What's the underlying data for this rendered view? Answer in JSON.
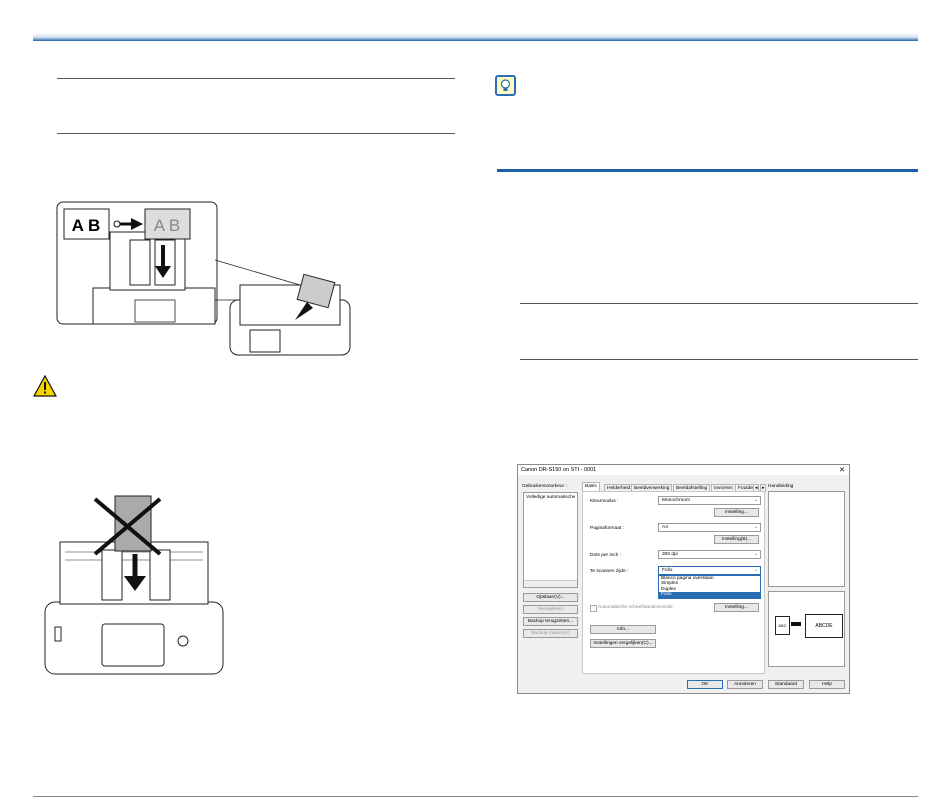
{
  "dialog": {
    "title": "Canon DR-S150 on STI - 0001",
    "close": "✕",
    "profiles_label": "Gebruikersvoorkeur :",
    "profile_item": "Volledige automatische",
    "profile_buttons": {
      "save": "Opslaan(V)...",
      "delete": "Verwijderen",
      "restore": "Backup terugzetten...",
      "backup": "Backup maken(K)"
    },
    "tabs": [
      "Basis",
      "Helderheid",
      "Beeldverwerking",
      "Beeldafstelling",
      "Invoeren",
      "Foutdet"
    ],
    "manual_label": "Handleiding",
    "fields": {
      "color_mode_label": "Kleurmodus :",
      "color_mode_value": "Monochroom",
      "page_size_label": "Paginaformaat :",
      "page_size_value": "A4",
      "dpi_label": "Dots per inch :",
      "dpi_value": "300 dpi",
      "side_label": "Te scannen zijde :",
      "side_value": "Folio"
    },
    "settings_buttons": {
      "color": "Instelling...",
      "size": "Instelling(B)...",
      "straighten": "Instelling..."
    },
    "side_options": [
      "Blanco pagina overslaan",
      "Simplex",
      "Duplex",
      "Folio"
    ],
    "side_selected_index": 3,
    "straighten_label": "Automatische scheefstandcorrectie",
    "info_button": "Info...",
    "compare_button": "Instellingen vergelijken(C)...",
    "footer_buttons": {
      "ok": "OK",
      "cancel": "Annuleren",
      "default": "Standaard",
      "help": "Help"
    },
    "preview": {
      "left_text": "ABC",
      "right_text": "ABCDE"
    }
  },
  "illustrations": {
    "top_box_left": "A B",
    "top_box_right": "A B"
  },
  "colors": {
    "accent": "#1f5fa5",
    "warning": "#f5d400",
    "tip_border": "#2a6db5"
  }
}
